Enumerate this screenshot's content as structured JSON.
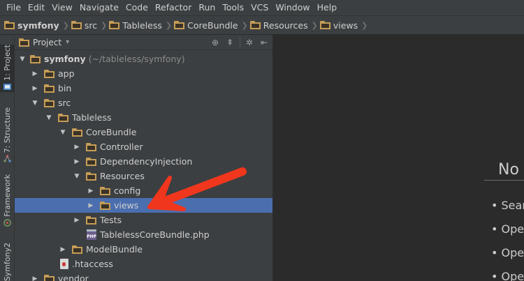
{
  "menu": [
    "File",
    "Edit",
    "View",
    "Navigate",
    "Code",
    "Refactor",
    "Run",
    "Tools",
    "VCS",
    "Window",
    "Help"
  ],
  "breadcrumb": [
    "symfony",
    "src",
    "Tableless",
    "CoreBundle",
    "Resources",
    "views"
  ],
  "left_strip": {
    "tabs": [
      "1: Project",
      "7: Structure",
      "Framework",
      "Symfony2"
    ]
  },
  "panel": {
    "title": "Project",
    "tools": [
      "sync-icon",
      "collapse-icon",
      "settings-icon",
      "hide-icon"
    ]
  },
  "tree": [
    {
      "label": "symfony",
      "hint": "(~/tableless/symfony)",
      "expanded": true,
      "bold": true
    },
    {
      "label": "app",
      "expanded": false
    },
    {
      "label": "bin",
      "expanded": false
    },
    {
      "label": "src",
      "expanded": true
    },
    {
      "label": "Tableless",
      "expanded": true
    },
    {
      "label": "CoreBundle",
      "expanded": true
    },
    {
      "label": "Controller",
      "expanded": false
    },
    {
      "label": "DependencyInjection",
      "expanded": false
    },
    {
      "label": "Resources",
      "expanded": true
    },
    {
      "label": "config",
      "expanded": false
    },
    {
      "label": "views",
      "expanded": false,
      "selected": true
    },
    {
      "label": "Tests",
      "expanded": false
    },
    {
      "label": "TablelessCoreBundle.php",
      "type": "php"
    },
    {
      "label": "ModelBundle",
      "expanded": false
    },
    {
      "label": ".htaccess",
      "type": "htaccess"
    },
    {
      "label": "vendor",
      "expanded": false
    }
  ],
  "editor": {
    "empty_title": "No",
    "hints": [
      "• Sear",
      "• Oper",
      "• Oper",
      "• Oper"
    ]
  },
  "colors": {
    "selection": "#4b6eaf",
    "folder": "#c69d57",
    "annotation_arrow": "#f0361c"
  }
}
